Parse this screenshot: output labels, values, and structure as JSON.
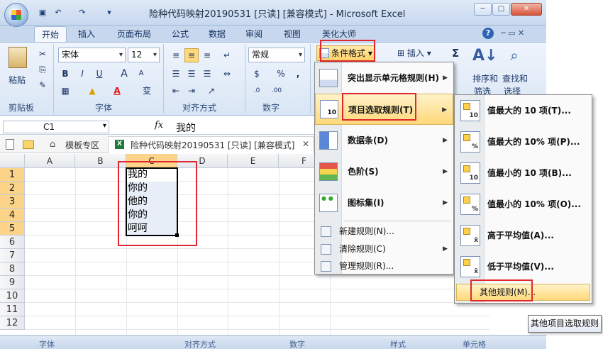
{
  "window": {
    "title": "险种代码映射20190531  [只读]  [兼容模式] - Microsoft Excel",
    "controls": [
      "─",
      "□",
      "✕"
    ]
  },
  "ribbon_tabs": [
    "开始",
    "插入",
    "页面布局",
    "公式",
    "数据",
    "审阅",
    "视图",
    "美化大师"
  ],
  "ribbon": {
    "clipboard": {
      "paste": "粘贴",
      "label": "剪贴板"
    },
    "font": {
      "name": "宋体",
      "size": "12",
      "label": "字体",
      "bold": "B",
      "italic": "I",
      "underline": "U",
      "grow": "A",
      "shrink": "A",
      "color_a": "A",
      "wen": "变"
    },
    "alignment": {
      "label": "对齐方式"
    },
    "number": {
      "format": "常规",
      "label": "数字",
      "percent": "%",
      "comma": ","
    },
    "styles": {
      "conditional_format": "条件格式"
    },
    "cells": {
      "insert": "插入"
    },
    "editing": {
      "sigma": "Σ",
      "sort_filter": "排序和",
      "sort_filter2": "筛选",
      "find_select": "查找和",
      "find_select2": "选择"
    }
  },
  "formula_bar": {
    "name_box": "C1",
    "fx": "fx",
    "value": "我的"
  },
  "doc_tabs": {
    "template": "模板专区",
    "file": "险种代码映射20190531  [只读]  [兼容模式]",
    "close": "✕"
  },
  "sheet": {
    "columns": [
      "A",
      "B",
      "C",
      "D",
      "E",
      "F"
    ],
    "rows": [
      "1",
      "2",
      "3",
      "4",
      "5",
      "6",
      "7",
      "8",
      "9",
      "10",
      "11",
      "12"
    ],
    "c_values": [
      "我的",
      "你的",
      "他的",
      "你的",
      "呵呵"
    ]
  },
  "status_bar": [
    "字体",
    "对齐方式",
    "数字",
    "样式",
    "单元格"
  ],
  "menu_conditional": {
    "items": [
      {
        "label": "突出显示单元格规则(H)",
        "icon": "highlight-cells-icon"
      },
      {
        "label": "项目选取规则(T)",
        "icon": "top-bottom-icon"
      },
      {
        "label": "数据条(D)",
        "icon": "data-bars-icon"
      },
      {
        "label": "色阶(S)",
        "icon": "color-scales-icon"
      },
      {
        "label": "图标集(I)",
        "icon": "icon-sets-icon"
      }
    ],
    "small_items": [
      {
        "label": "新建规则(N)...",
        "icon": "new-rule-icon"
      },
      {
        "label": "清除规则(C)",
        "icon": "clear-rules-icon"
      },
      {
        "label": "管理规则(R)...",
        "icon": "manage-rules-icon"
      }
    ]
  },
  "menu_top_bottom": {
    "items": [
      {
        "label": "值最大的 10 项(T)...",
        "badge": "10"
      },
      {
        "label": "值最大的 10% 项(P)...",
        "badge": "%"
      },
      {
        "label": "值最小的 10 项(B)...",
        "badge": "10"
      },
      {
        "label": "值最小的 10% 项(O)...",
        "badge": "%"
      },
      {
        "label": "高于平均值(A)...",
        "badge": "x̄"
      },
      {
        "label": "低于平均值(V)...",
        "badge": "x̄"
      }
    ],
    "more": "其他规则(M)..."
  },
  "tooltip": "其他项目选取规则",
  "colors": {
    "highlight": "#ffd87a",
    "annotation_red": "#e0282e",
    "ribbon_blue": "#c7d8ee"
  }
}
